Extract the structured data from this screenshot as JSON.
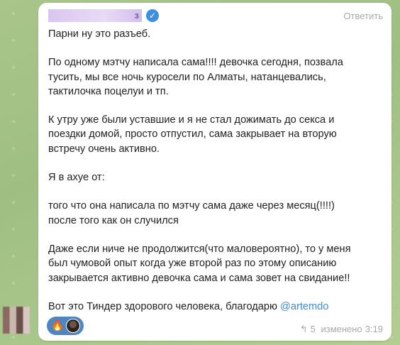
{
  "message": {
    "sender_suffix": "з",
    "reply_label": "Ответить",
    "paragraphs": [
      "Парни ну это разъеб.",
      "По одному мэтчу написала сама!!!! девочка сегодня, позвала\nтусить, мы все ночь куросели по Алматы, натанцевались,\nтактилочка поцелуи и тп.",
      "К утру уже были уставшие и я не стал дожимать до секса и\nпоездки домой, просто отпустил, сама закрывает на вторую\nвстречу очень активно.",
      "Я в ахуе от:",
      "того что она написала по мэтчу сама даже через месяц(!!!!)\nпосле того как он случился",
      "Даже если ниче не продолжится(что маловероятно), то у меня\nбыл чумовой опыт когда уже второй раз по этому описанию\nзакрывается активно девочка сама и сама зовет на свидание!!"
    ],
    "last_line_prefix": "Вот это Тиндер здорового человека, благодарю ",
    "mention": "@artemdo",
    "replies_icon": "↰",
    "reply_count": "5",
    "edited_label": "изменено",
    "time": "3:19",
    "reaction_emoji": "🔥"
  },
  "icons": {
    "verified": "verified-badge-icon",
    "reaction": "fire-icon",
    "replies": "reply-arrow-icon"
  },
  "colors": {
    "accent": "#3b8bd9",
    "sender_name": "#7a5bb0",
    "reaction_bg": "#4f86c2",
    "meta": "#a8a8a8"
  }
}
